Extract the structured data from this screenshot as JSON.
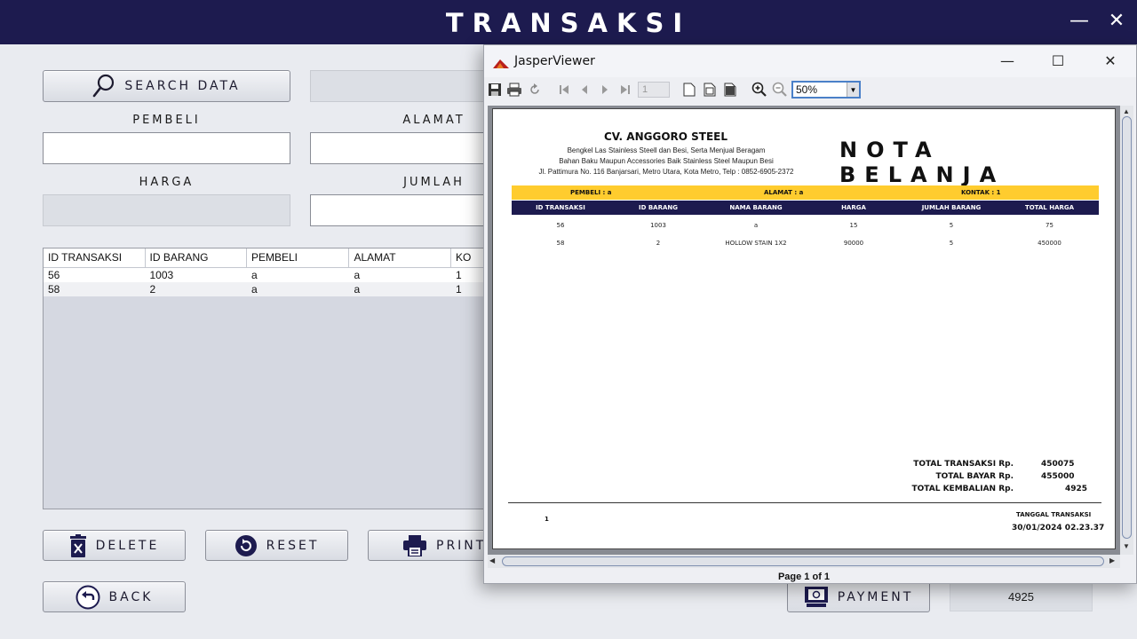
{
  "app": {
    "title": "TRANSAKSI",
    "minimize": "—",
    "close": "✕"
  },
  "form": {
    "search_button": "SEARCH DATA",
    "labels": {
      "pembeli": "PEMBELI",
      "alamat": "ALAMAT",
      "harga": "HARGA",
      "jumlah": "JUMLAH"
    },
    "values": {
      "search": "",
      "pembeli": "",
      "alamat": "",
      "harga": "",
      "jumlah": ""
    }
  },
  "table": {
    "columns": [
      "ID TRANSAKSI",
      "ID BARANG",
      "PEMBELI",
      "ALAMAT",
      "KO"
    ],
    "rows": [
      [
        "56",
        "1003",
        "a",
        "a",
        "1"
      ],
      [
        "58",
        "2",
        "a",
        "a",
        "1"
      ]
    ]
  },
  "buttons": {
    "delete": "DELETE",
    "reset": "RESET",
    "print": "PRINT",
    "back": "BACK",
    "payment": "PAYMENT"
  },
  "kembalian_display": "4925",
  "viewer": {
    "title": "JasperViewer",
    "page_number": "1",
    "zoom": "50%",
    "page_status": "Page 1 of 1",
    "report": {
      "company": "CV. ANGGORO STEEL",
      "lines": [
        "Bengkel Las Stainless Steell dan Besi, Serta Menjual Beragam",
        "Bahan Baku Maupun Accessories Baik Stainless Steel Maupun Besi",
        "Jl. Pattimura No. 116 Banjarsari, Metro Utara, Kota Metro, Telp : 0852-6905-2372"
      ],
      "heading": "NOTA BELANJA",
      "pembeli": "PEMBELI :  a",
      "alamat": "ALAMAT :  a",
      "kontak": "KONTAK :  1",
      "columns": [
        "ID TRANSAKSI",
        "ID BARANG",
        "NAMA BARANG",
        "HARGA",
        "JUMLAH BARANG",
        "TOTAL HARGA"
      ],
      "rows": [
        [
          "56",
          "1003",
          "a",
          "15",
          "5",
          "75"
        ],
        [
          "58",
          "2",
          "HOLLOW STAIN 1X2",
          "90000",
          "5",
          "450000"
        ]
      ],
      "totals": [
        {
          "label": "TOTAL TRANSAKSI Rp.",
          "value": "450075"
        },
        {
          "label": "TOTAL BAYAR Rp.",
          "value": "455000"
        },
        {
          "label": "TOTAL KEMBALIAN Rp.",
          "value": "4925"
        }
      ],
      "page_footer_number": "1",
      "tanggal_label": "TANGGAL TRANSAKSI",
      "tanggal_value": "30/01/2024 02.23.37"
    }
  },
  "colors": {
    "header": "#1d1b4f",
    "accent_yellow": "#ffcc2e",
    "zoom_focus": "#4a80c8"
  },
  "icons": [
    "search-icon",
    "trash-icon",
    "reset-icon",
    "printer-icon",
    "back-icon",
    "payment-icon",
    "jasper-logo-icon"
  ]
}
